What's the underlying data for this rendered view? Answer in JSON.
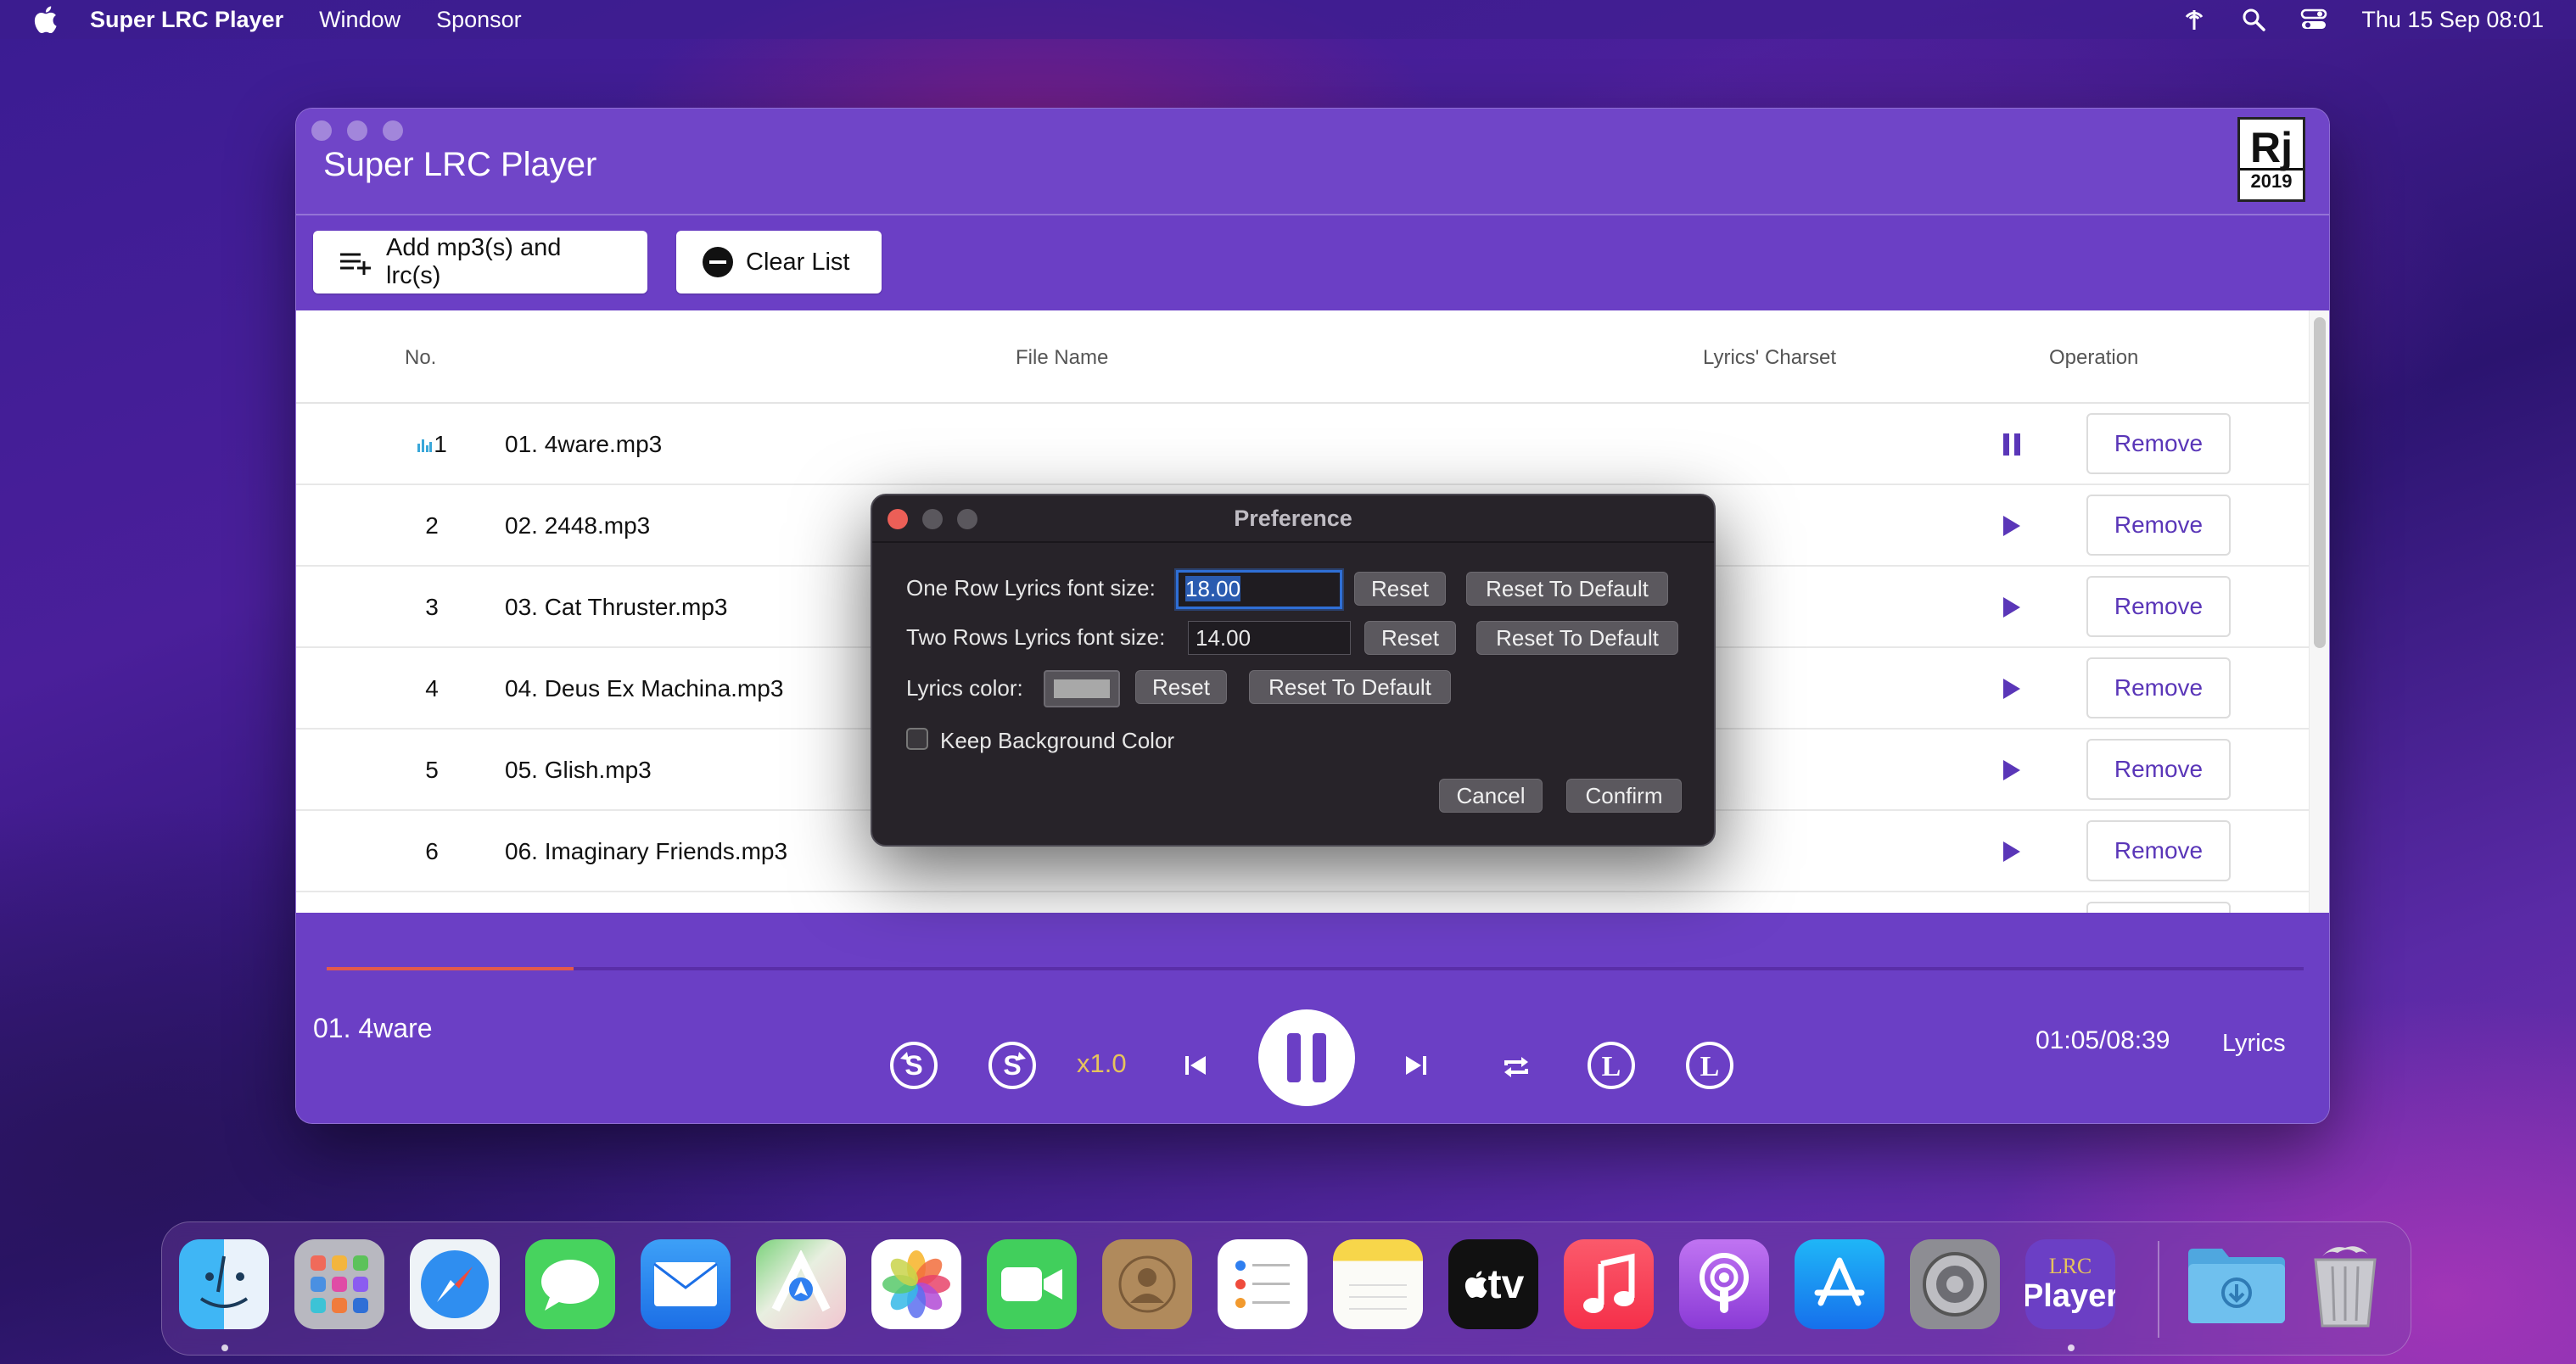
{
  "menubar": {
    "app_name": "Super LRC Player",
    "items": [
      "Window",
      "Sponsor"
    ],
    "clock": "Thu 15 Sep  08:01"
  },
  "window": {
    "title": "Super LRC Player",
    "logo": {
      "text": "Rj",
      "year": "2019"
    }
  },
  "toolbar": {
    "add_label": "Add mp3(s) and lrc(s)",
    "clear_label": "Clear List"
  },
  "table": {
    "headers": {
      "no": "No.",
      "file_name": "File Name",
      "charset": "Lyrics' Charset",
      "operation": "Operation"
    },
    "remove_label": "Remove",
    "rows": [
      {
        "no": "1",
        "file": "01. 4ware.mp3",
        "playing": true
      },
      {
        "no": "2",
        "file": "02. 2448.mp3",
        "playing": false
      },
      {
        "no": "3",
        "file": "03. Cat Thruster.mp3",
        "playing": false
      },
      {
        "no": "4",
        "file": "04. Deus Ex Machina.mp3",
        "playing": false
      },
      {
        "no": "5",
        "file": "05. Glish.mp3",
        "playing": false
      },
      {
        "no": "6",
        "file": "06. Imaginary Friends.mp3",
        "playing": false
      }
    ]
  },
  "player": {
    "now_playing": "01. 4ware",
    "speed": "x1.0",
    "time": "01:05/08:39",
    "lyrics_label": "Lyrics",
    "progress": 0.125
  },
  "dialog": {
    "title": "Preference",
    "one_row_label": "One Row Lyrics font size:",
    "one_row_value": "18.00",
    "two_rows_label": "Two Rows Lyrics font size:",
    "two_rows_value": "14.00",
    "color_label": "Lyrics color:",
    "reset_label": "Reset",
    "reset_default_label": "Reset To Default",
    "keep_bg_label": "Keep Background Color",
    "cancel_label": "Cancel",
    "confirm_label": "Confirm"
  },
  "dock": {
    "apps": [
      "finder-icon",
      "launchpad-icon",
      "safari-icon",
      "messages-icon",
      "mail-icon",
      "maps-icon",
      "photos-icon",
      "facetime-icon",
      "contacts-icon",
      "reminders-icon",
      "notes-icon",
      "appletv-icon",
      "music-icon",
      "podcasts-icon",
      "appstore-icon",
      "system-preferences-icon",
      "lrc-player-icon"
    ],
    "tv_label": "tv",
    "lrc_label_top": "LRC",
    "lrc_label_bottom": "Player"
  },
  "colors": {
    "accent": "#6b3fc5",
    "progress": "#e25a4c",
    "speed": "#e6c35c",
    "remove_text": "#5a36b8"
  }
}
